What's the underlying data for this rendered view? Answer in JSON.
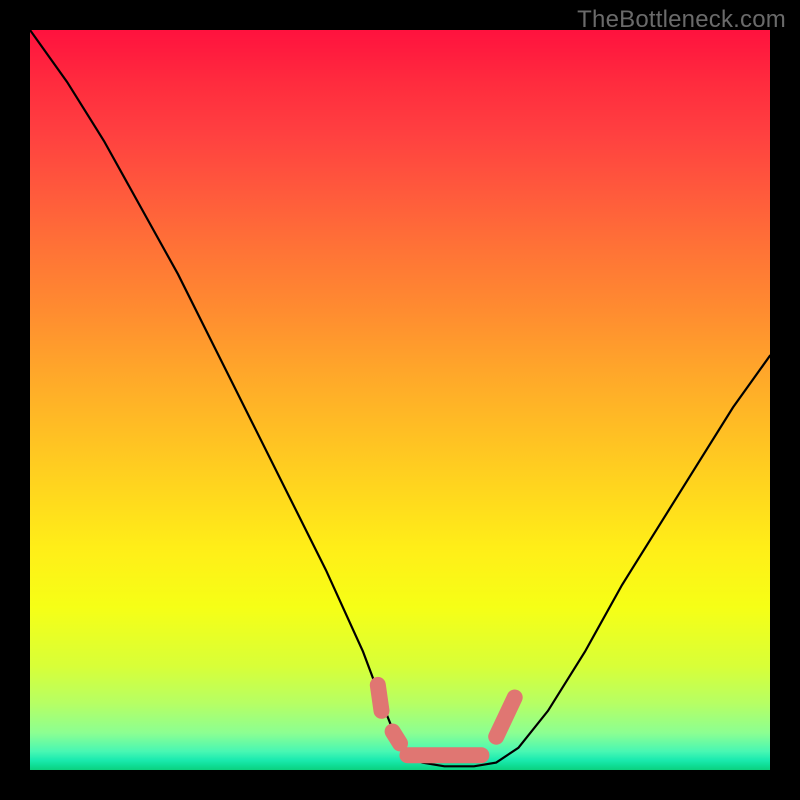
{
  "watermark_text": "TheBottleneck.com",
  "colors": {
    "frame_border": "#000000",
    "curve": "#000000",
    "marker": "#e07672",
    "gradient_top": "#ff123e",
    "gradient_bottom": "#0cd07e"
  },
  "chart_data": {
    "type": "line",
    "title": "",
    "xlabel": "",
    "ylabel": "",
    "xlim": [
      0,
      100
    ],
    "ylim": [
      0,
      100
    ],
    "grid": false,
    "legend": false,
    "series": [
      {
        "name": "bottleneck-curve",
        "x": [
          0,
          5,
          10,
          15,
          20,
          25,
          30,
          35,
          40,
          45,
          48,
          50,
          53,
          56,
          60,
          63,
          66,
          70,
          75,
          80,
          85,
          90,
          95,
          100
        ],
        "values": [
          100,
          93,
          85,
          76,
          67,
          57,
          47,
          37,
          27,
          16,
          8,
          3,
          1,
          0.5,
          0.5,
          1,
          3,
          8,
          16,
          25,
          33,
          41,
          49,
          56
        ]
      }
    ],
    "marker": {
      "name": "near-zero-bottleneck-band",
      "segments": [
        {
          "x": [
            47,
            47.5
          ],
          "y": [
            11.5,
            8
          ]
        },
        {
          "x": [
            49,
            50
          ],
          "y": [
            5.2,
            3.6
          ]
        },
        {
          "x": [
            51,
            61
          ],
          "y": [
            2.0,
            2.0
          ]
        },
        {
          "x": [
            63,
            65.5
          ],
          "y": [
            4.5,
            9.8
          ]
        }
      ]
    },
    "annotations": [
      {
        "text": "TheBottleneck.com",
        "position": "top-right"
      }
    ]
  }
}
